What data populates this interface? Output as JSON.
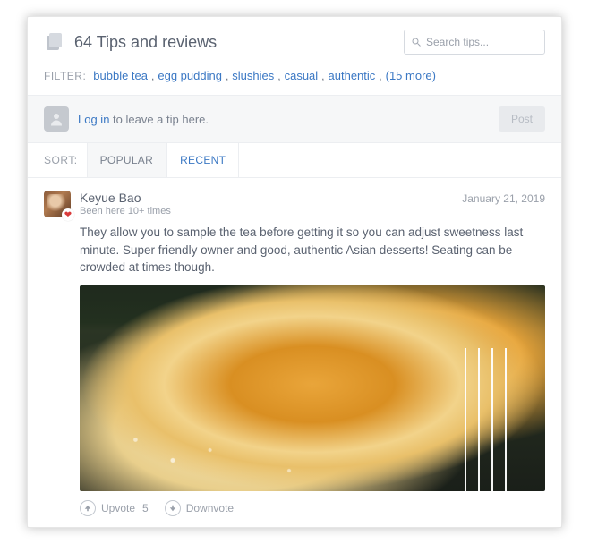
{
  "header": {
    "title": "64 Tips and reviews",
    "search_placeholder": "Search tips..."
  },
  "filter": {
    "label": "FILTER:",
    "tags": [
      "bubble tea",
      "egg pudding",
      "slushies",
      "casual",
      "authentic"
    ],
    "more": "(15 more)"
  },
  "prompt": {
    "login_text": "Log in",
    "rest_text": " to leave a tip here.",
    "post_label": "Post"
  },
  "sort": {
    "label": "SORT:",
    "tabs": [
      {
        "key": "popular",
        "label": "POPULAR",
        "active": true
      },
      {
        "key": "recent",
        "label": "RECENT",
        "active": false
      }
    ]
  },
  "tips": [
    {
      "author": "Keyue Bao",
      "date": "January 21, 2019",
      "visits": "Been here 10+ times",
      "heart": "❤",
      "text": "They allow you to sample the tea before getting it so you can adjust sweetness last minute. Super friendly owner and good, authentic Asian desserts! Seating can be crowded at times though.",
      "upvote_label": "Upvote",
      "upvote_count": "5",
      "downvote_label": "Downvote"
    }
  ]
}
